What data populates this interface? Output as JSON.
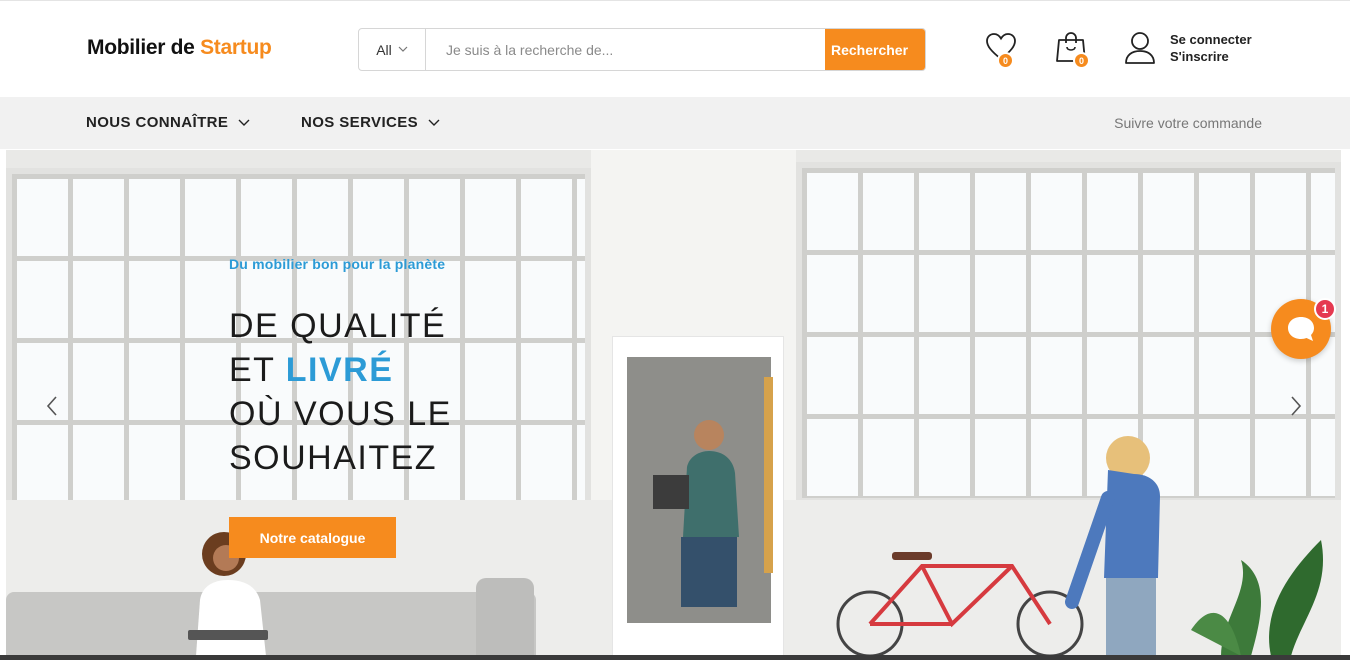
{
  "header": {
    "logo": {
      "part1": "Mobilier de ",
      "part2": "Startup"
    },
    "search": {
      "category": "All",
      "placeholder": "Je suis à la recherche de...",
      "value": "",
      "button_label": "Rechercher"
    },
    "wishlist": {
      "icon": "heart-icon",
      "count": "0"
    },
    "cart": {
      "icon": "shopping-bag-icon",
      "count": "0"
    },
    "account": {
      "icon": "user-icon",
      "login_label": "Se connecter",
      "register_label": "S'inscrire"
    }
  },
  "nav": {
    "items": [
      {
        "label": "NOUS CONNAÎTRE",
        "icon": "chevron-down-icon"
      },
      {
        "label": "NOS SERVICES",
        "icon": "chevron-down-icon"
      }
    ],
    "track_order": "Suivre votre commande"
  },
  "hero": {
    "subtitle": "Du mobilier bon pour la planète",
    "title": {
      "line1": "DE QUALITÉ",
      "line2_prefix": "ET ",
      "line2_highlight": "LIVRÉ",
      "line3": "OÙ VOUS LE",
      "line4": "SOUHAITEZ"
    },
    "cta_label": "Notre catalogue",
    "prev_icon": "chevron-left-icon",
    "next_icon": "chevron-right-icon"
  },
  "chat": {
    "icon": "chat-bubble-icon",
    "unread": "1"
  },
  "colors": {
    "accent": "#f68b1e",
    "highlight": "#2c9bd6",
    "badge_red": "#e53950",
    "nav_background": "#f1f1f1"
  }
}
